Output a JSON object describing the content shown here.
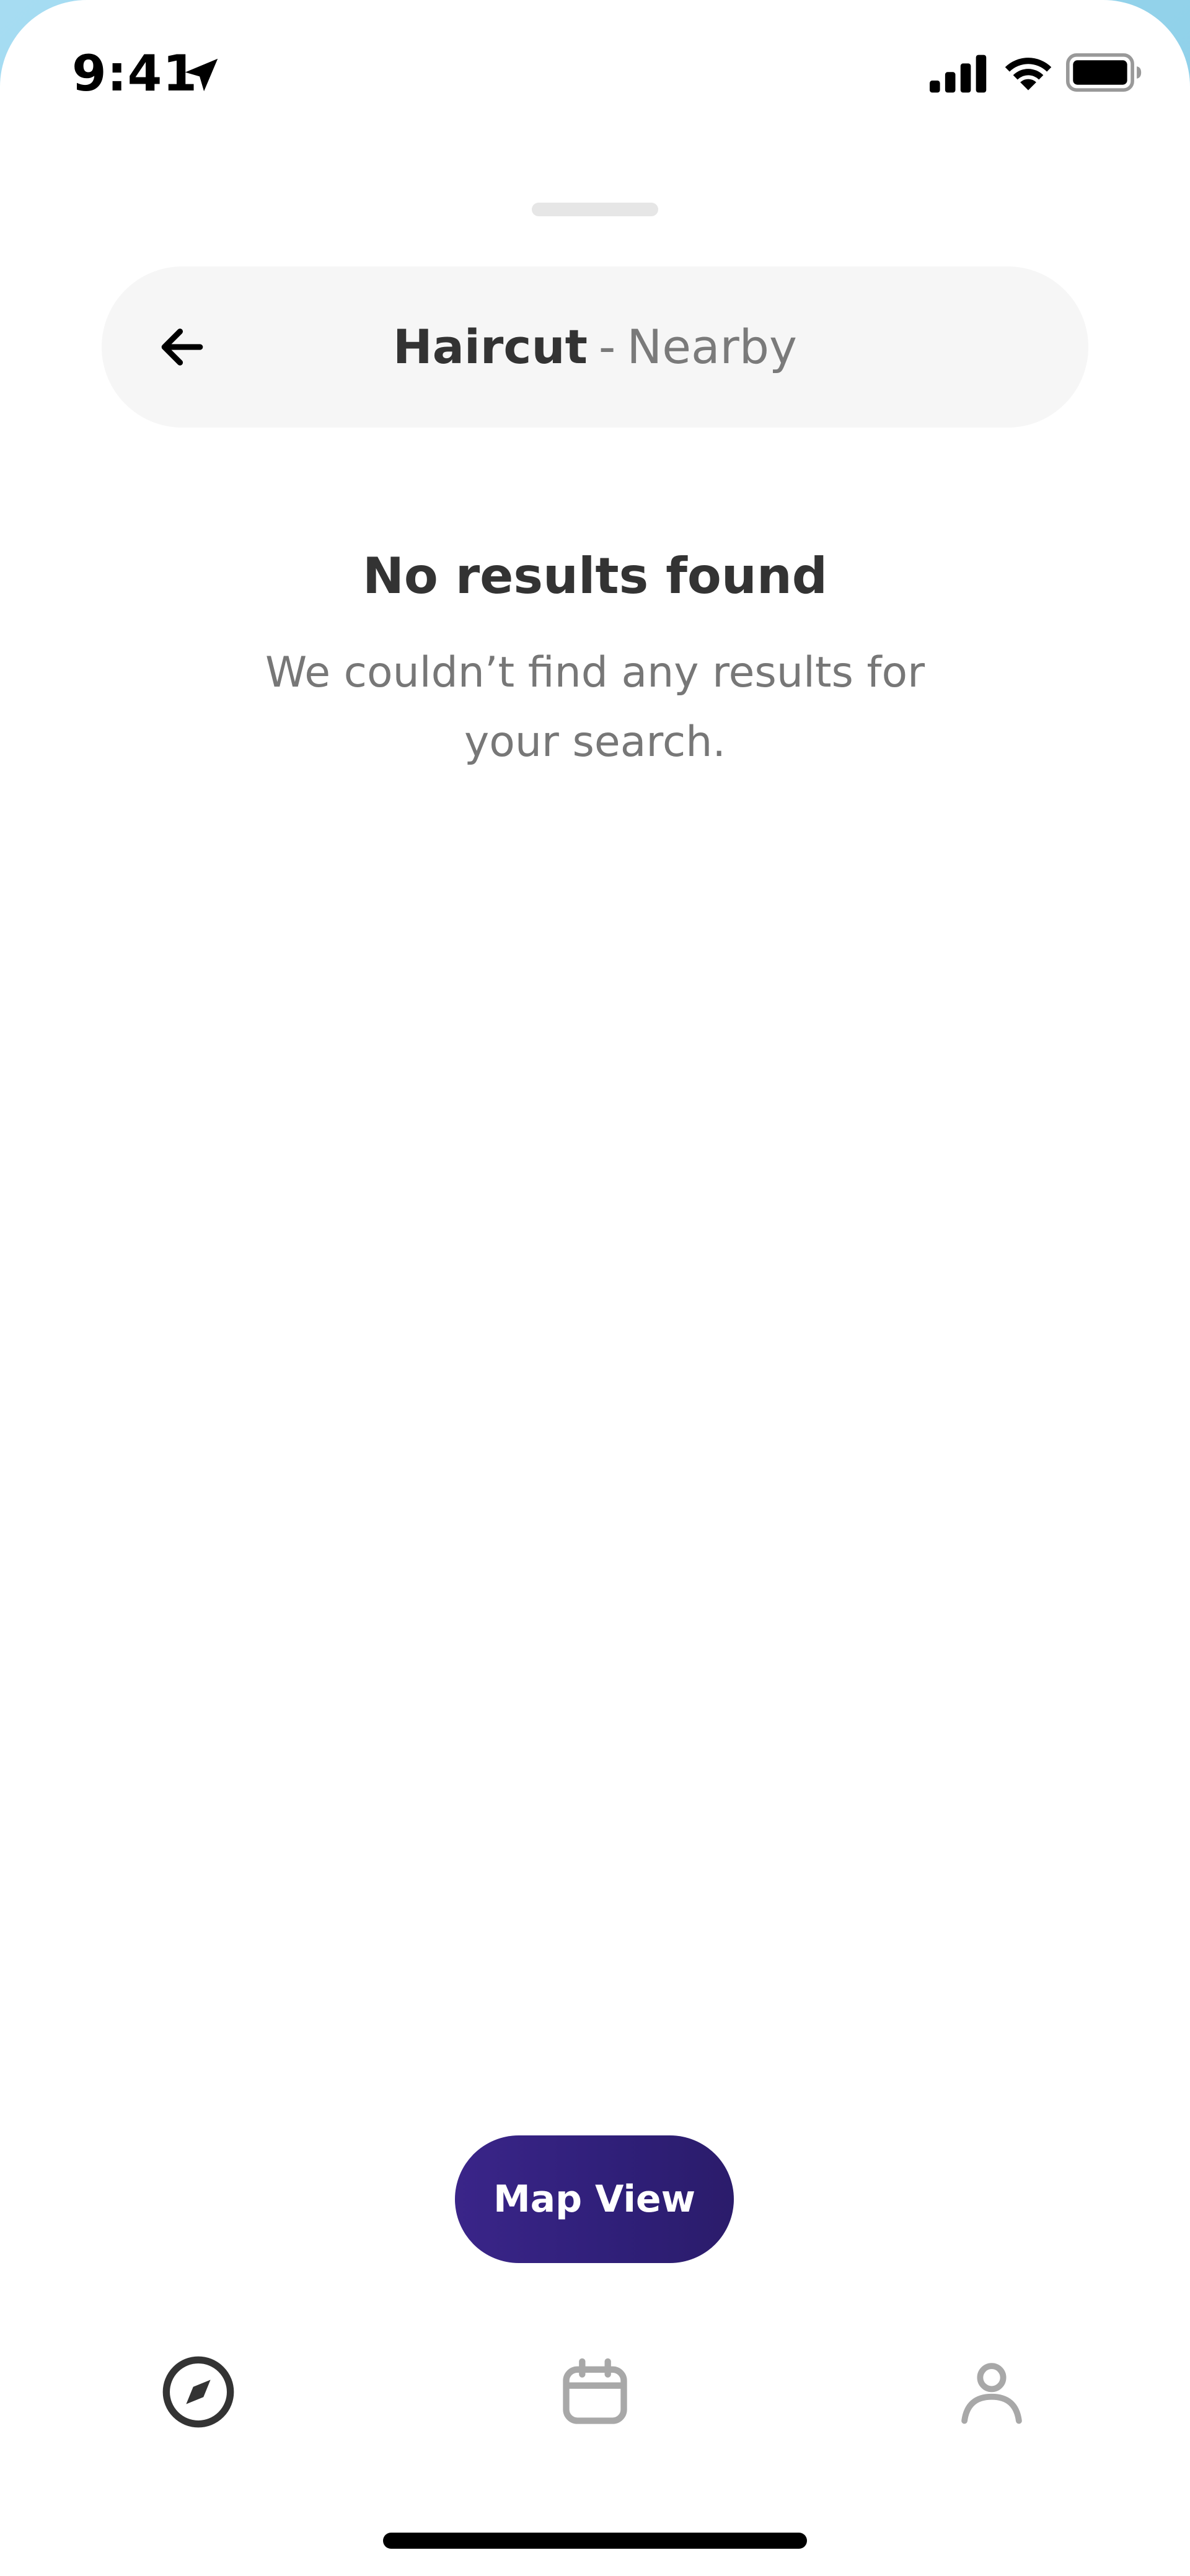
{
  "status_bar": {
    "time": "9:41"
  },
  "search": {
    "term": "Haircut",
    "separator": "-",
    "scope": "Nearby"
  },
  "empty_state": {
    "title": "No results found",
    "description": "We couldn’t find any results for your search."
  },
  "map_button": {
    "label": "Map View"
  },
  "tab_bar": {
    "items": [
      {
        "icon": "compass-icon",
        "active": true
      },
      {
        "icon": "calendar-icon",
        "active": false
      },
      {
        "icon": "user-icon",
        "active": false
      }
    ]
  },
  "colors": {
    "primary": "#2f1f78",
    "text_dark": "#333333",
    "text_muted": "#777777",
    "pill_bg": "#f6f6f6",
    "inactive_icon": "#a8a8a8"
  }
}
